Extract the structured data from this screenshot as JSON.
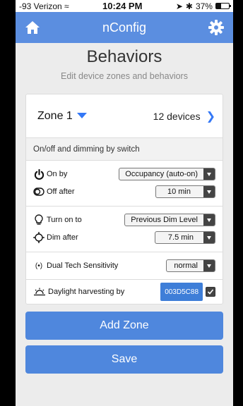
{
  "status": {
    "carrier": "-93 Verizon",
    "time": "10:24 PM",
    "battery": "37%",
    "battery_level": 0.37
  },
  "nav": {
    "title": "nConfig"
  },
  "header": {
    "title": "Behaviors",
    "subtitle": "Edit device zones and behaviors"
  },
  "zone": {
    "name": "Zone 1",
    "devices": "12 devices"
  },
  "section": {
    "title": "On/off and dimming by switch"
  },
  "rows": {
    "on_by": {
      "label": "On by",
      "value": "Occupancy (auto-on)"
    },
    "off_after": {
      "label": "Off after",
      "value": "10 min"
    },
    "turn_on_to": {
      "label": "Turn on to",
      "value": "Previous Dim Level"
    },
    "dim_after": {
      "label": "Dim after",
      "value": "7.5 min"
    },
    "dual_tech": {
      "label": "Dual Tech Sensitivity",
      "value": "normal"
    },
    "daylight": {
      "label": "Daylight harvesting by",
      "value": "003D5C88"
    }
  },
  "buttons": {
    "add_zone": "Add Zone",
    "save": "Save"
  },
  "colors": {
    "accent": "#5b8ee0",
    "button": "#4f87dd",
    "link": "#3478f6"
  }
}
